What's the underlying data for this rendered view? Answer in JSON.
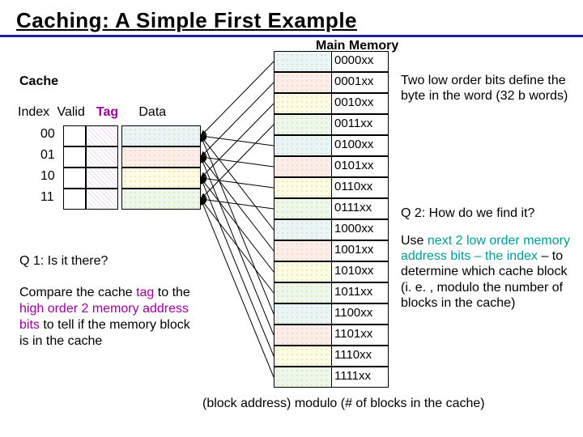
{
  "title": "Caching:  A Simple First Example",
  "labels": {
    "main_memory": "Main Memory",
    "cache": "Cache",
    "headers": {
      "index": "Index",
      "valid": "Valid",
      "tag": "Tag",
      "data": "Data"
    }
  },
  "cache_rows": [
    "00",
    "01",
    "10",
    "11"
  ],
  "mm_rows": [
    "0000xx",
    "0001xx",
    "0010xx",
    "0011xx",
    "0100xx",
    "0101xx",
    "0110xx",
    "0111xx",
    "1000xx",
    "1001xx",
    "1010xx",
    "1011xx",
    "1100xx",
    "1101xx",
    "1110xx",
    "1111xx"
  ],
  "right": {
    "r1": "Two low order bits define the byte in the word (32 b words)",
    "r2": "Q 2: How do we find it?",
    "r3a": "Use ",
    "r3b": "next 2 low order memory address bits – the index",
    "r3c": " – to determine which cache block (i. e. , modulo the number of blocks in the cache)"
  },
  "left": {
    "q1": "Q 1: Is it there?",
    "p1a": "Compare the cache ",
    "p1b": "tag",
    "p1c": " to the ",
    "p1d": "high order 2 memory address bits",
    "p1e": " to tell if the memory block is in the cache"
  },
  "bottom": "(block address) modulo (# of blocks in the cache)"
}
